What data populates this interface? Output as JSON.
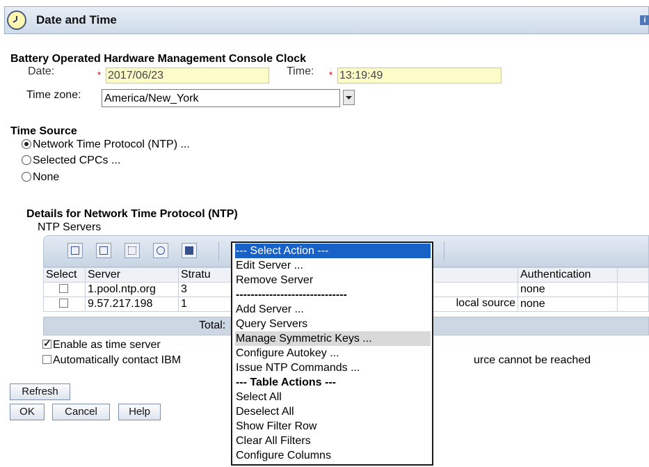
{
  "window": {
    "title": "Date and Time",
    "info_glyph": "i"
  },
  "clock_section": {
    "heading": "Battery Operated Hardware Management Console Clock",
    "date_label": "Date:",
    "date_value": "2017/06/23",
    "time_label": "Time:",
    "time_value": "13:19:49",
    "required_mark": "*",
    "timezone_label": "Time zone:",
    "timezone_value": "America/New_York"
  },
  "time_source": {
    "heading": "Time Source",
    "options": [
      {
        "label": "Network Time Protocol (NTP) ...",
        "selected": true
      },
      {
        "label": "Selected CPCs ...",
        "selected": false
      },
      {
        "label": "None",
        "selected": false
      }
    ]
  },
  "ntp_details": {
    "heading": "Details for Network Time Protocol (NTP)",
    "servers_label": "NTP Servers",
    "columns": [
      "Select",
      "Server",
      "Stratu",
      "Authentication"
    ],
    "rows": [
      {
        "server": "1.pool.ntp.org",
        "stratum": "3",
        "source": "",
        "auth": "none"
      },
      {
        "server": "9.57.217.198",
        "stratum": "1",
        "source": "local source",
        "auth": "none"
      }
    ],
    "total_label": "Total:",
    "enable_time_server_label": "Enable as time server",
    "auto_contact_prefix": "Automatically contact IBM",
    "auto_contact_suffix": "urce cannot be reached"
  },
  "buttons": {
    "refresh": "Refresh",
    "ok": "OK",
    "cancel": "Cancel",
    "help": "Help"
  },
  "action_menu": {
    "selected": "--- Select Action ---",
    "items": [
      {
        "label": "--- Select Action ---",
        "state": "selected"
      },
      {
        "label": "Edit Server ...",
        "state": ""
      },
      {
        "label": "Remove Server",
        "state": ""
      },
      {
        "label": "------------------------------",
        "state": ""
      },
      {
        "label": "Add Server ...",
        "state": ""
      },
      {
        "label": "Query Servers",
        "state": ""
      },
      {
        "label": "Manage Symmetric Keys ...",
        "state": "hover"
      },
      {
        "label": "Configure Autokey ...",
        "state": ""
      },
      {
        "label": "Issue NTP Commands ...",
        "state": ""
      },
      {
        "label": "--- Table Actions ---",
        "state": "bold"
      },
      {
        "label": "Select All",
        "state": ""
      },
      {
        "label": "Deselect All",
        "state": ""
      },
      {
        "label": "Show Filter Row",
        "state": ""
      },
      {
        "label": "Clear All Filters",
        "state": ""
      },
      {
        "label": "Configure Columns",
        "state": ""
      }
    ]
  },
  "colors": {
    "selection": "#1862c7",
    "input_bg": "#fdfbc8",
    "header_gradient_top": "#e8eef6"
  }
}
